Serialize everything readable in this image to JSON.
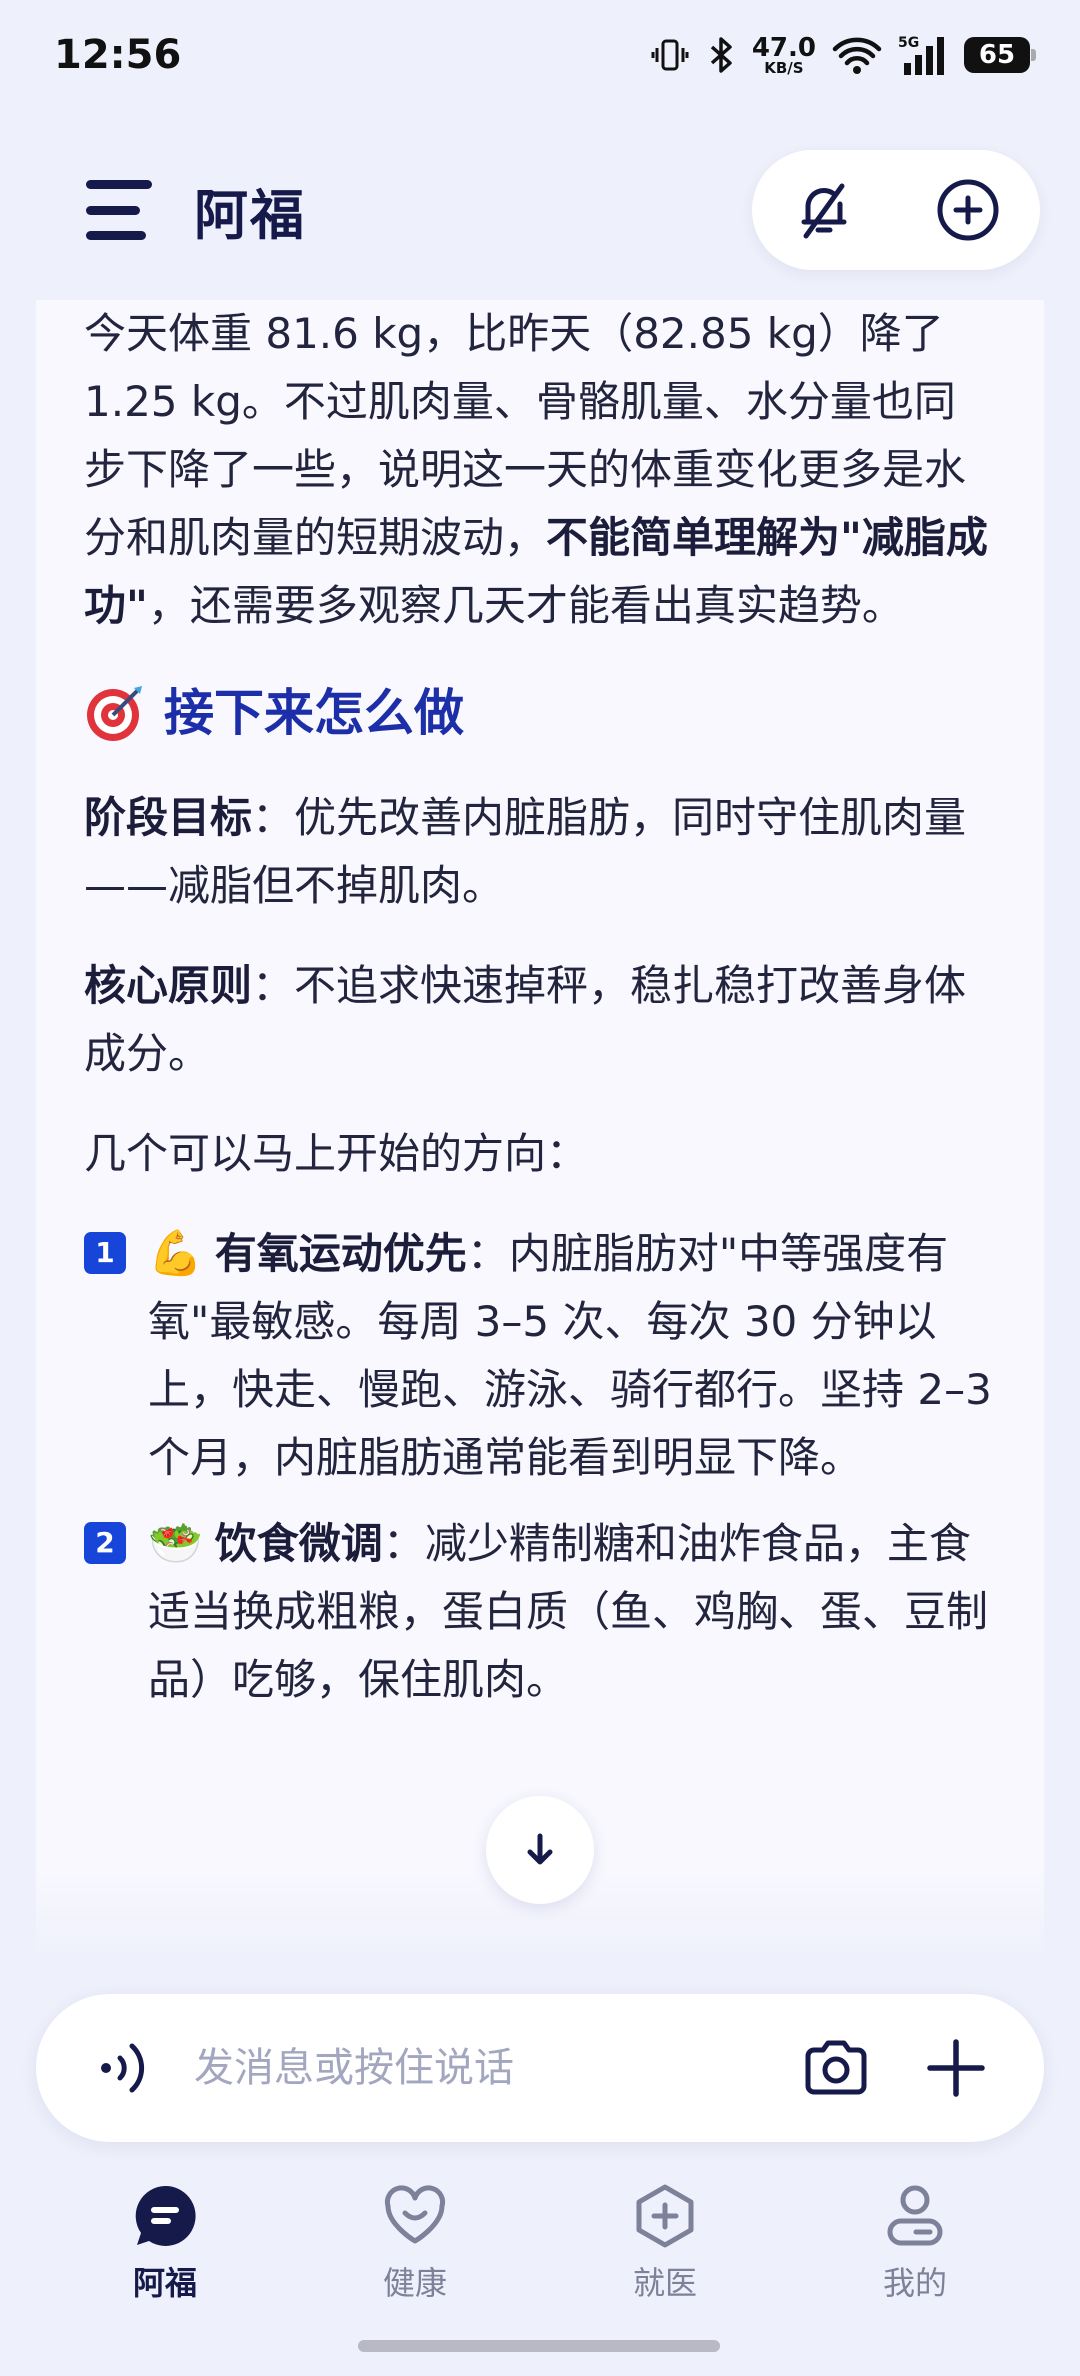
{
  "status_bar": {
    "time": "12:56",
    "net_speed_value": "47.0",
    "net_speed_unit": "KB/S",
    "network_type": "5G",
    "battery": "65"
  },
  "header": {
    "title": "阿福"
  },
  "chat": {
    "intro": {
      "text_1": "今天体重 81.6 kg，比昨天（82.85 kg）降了 1.25 kg。不过肌肉量、骨骼肌量、水分量也同步下降了一些，说明这一天的体重变化更多是水分和肌肉量的短期波动，",
      "bold": "不能简单理解为\"减脂成功\"",
      "text_2": "，还需要多观察几天才能看出真实趋势。"
    },
    "section_title": "接下来怎么做",
    "stage_goal": {
      "label": "阶段目标",
      "text": "：优先改善内脏脂肪，同时守住肌肉量——减脂但不掉肌肉。"
    },
    "core_principle": {
      "label": "核心原则",
      "text": "：不追求快速掉秤，稳扎稳打改善身体成分。"
    },
    "directions_intro": "几个可以马上开始的方向：",
    "items": [
      {
        "num": "1",
        "emoji": "💪",
        "label": "有氧运动优先",
        "text": "：内脏脂肪对\"中等强度有氧\"最敏感。每周 3–5 次、每次 30 分钟以上，快走、慢跑、游泳、骑行都行。坚持 2–3 个月，内脏脂肪通常能看到明显下降。"
      },
      {
        "num": "2",
        "emoji": "🥗",
        "label": "饮食微调",
        "text": "：减少精制糖和油炸食品，主食适当换成粗粮，蛋白质（鱼、鸡胸、蛋、豆制品）吃够，保住肌肉。"
      }
    ]
  },
  "input": {
    "placeholder": "发消息或按住说话"
  },
  "nav": {
    "items": [
      {
        "label": "阿福",
        "active": true
      },
      {
        "label": "健康",
        "active": false
      },
      {
        "label": "就医",
        "active": false
      },
      {
        "label": "我的",
        "active": false
      }
    ]
  },
  "colors": {
    "accent": "#1d2fa8",
    "badge": "#1745d9",
    "dark": "#161a4a",
    "background": "#eef0fb"
  }
}
